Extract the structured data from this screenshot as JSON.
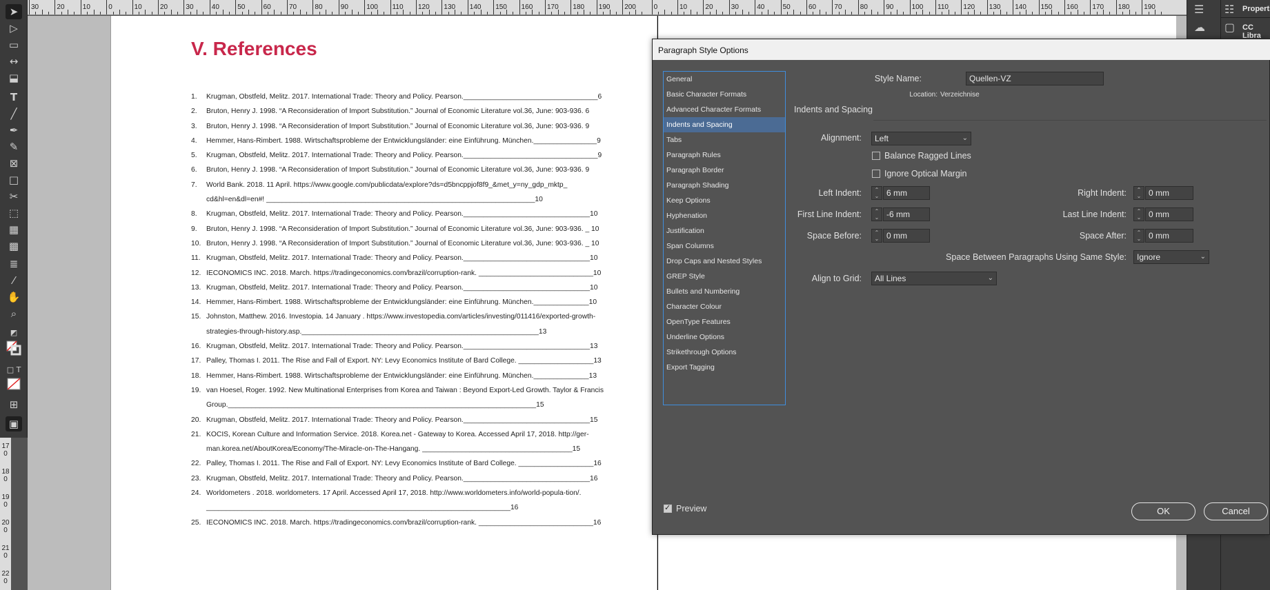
{
  "ruler": {
    "top_labels": [
      "30",
      "20",
      "10",
      "0",
      "10",
      "20",
      "30",
      "40",
      "50",
      "60",
      "70",
      "80",
      "90",
      "100",
      "110",
      "120",
      "130",
      "140",
      "150",
      "160",
      "170",
      "180",
      "190",
      "200",
      "0",
      "10",
      "20",
      "30",
      "40",
      "50",
      "60",
      "70",
      "80",
      "90",
      "100",
      "110",
      "120",
      "130",
      "140",
      "150",
      "160",
      "170",
      "180",
      "190"
    ],
    "left_labels": [
      "170",
      "180",
      "190",
      "200",
      "210",
      "220"
    ]
  },
  "document": {
    "heading": "V.  References",
    "references": [
      {
        "num": "1.",
        "text": "Krugman, Obstfeld, Melitz. 2017. International Trade: Theory and Policy. Pearson.__________________________________6"
      },
      {
        "num": "2.",
        "text": "Bruton, Henry J. 1998. “A Reconsideration of Import Substitution.” Journal of Economic Literature vol.36, June: 903-936.  6"
      },
      {
        "num": "3.",
        "text": "Bruton, Henry J. 1998. “A Reconsideration of Import Substitution.” Journal of Economic Literature vol.36, June: 903-936.  9"
      },
      {
        "num": "4.",
        "text": "Hemmer, Hans-Rimbert. 1988. Wirtschaftsprobleme der Entwicklungsländer: eine Einführung. München.________________9"
      },
      {
        "num": "5.",
        "text": "Krugman, Obstfeld, Melitz. 2017. International Trade: Theory and Policy. Pearson.__________________________________9"
      },
      {
        "num": "6.",
        "text": "Bruton, Henry J. 1998. “A Reconsideration of Import Substitution.” Journal of Economic Literature vol.36, June: 903-936.  9"
      },
      {
        "num": "7.",
        "text": "World Bank. 2018. 11 April. https://www.google.com/publicdata/explore?ds=d5bncppjof8f9_&met_y=ny_gdp_mktp_ cd&hl=en&dl=en#! ____________________________________________________________________10"
      },
      {
        "num": "8.",
        "text": "Krugman, Obstfeld, Melitz. 2017. International Trade: Theory and Policy. Pearson.________________________________10"
      },
      {
        "num": "9.",
        "text": "Bruton, Henry J. 1998. “A Reconsideration of Import Substitution.” Journal of Economic Literature vol.36, June: 903-936. _ 10"
      },
      {
        "num": "10.",
        "text": "Bruton, Henry J. 1998. “A Reconsideration of Import Substitution.” Journal of Economic Literature vol.36, June: 903-936. _ 10"
      },
      {
        "num": "11.",
        "text": "Krugman, Obstfeld, Melitz. 2017. International Trade: Theory and Policy. Pearson.________________________________10"
      },
      {
        "num": "12.",
        "text": "IECONOMICS INC. 2018. March. https://tradingeconomics.com/brazil/corruption-rank. _____________________________10"
      },
      {
        "num": "13.",
        "text": "Krugman, Obstfeld, Melitz. 2017. International Trade: Theory and Policy. Pearson.________________________________10"
      },
      {
        "num": "14.",
        "text": "Hemmer, Hans-Rimbert. 1988. Wirtschaftsprobleme der Entwicklungsländer: eine Einführung. München.______________10"
      },
      {
        "num": "15.",
        "text": "Johnston, Matthew. 2016. Investopia. 14 January . https://www.investopedia.com/articles/investing/011416/exported-growth-strategies-through-history.asp.____________________________________________________________13"
      },
      {
        "num": "16.",
        "text": "Krugman, Obstfeld, Melitz. 2017. International Trade: Theory and Policy. Pearson.________________________________13"
      },
      {
        "num": "17.",
        "text": "Palley, Thomas I. 2011. The Rise and Fall of Export. NY: Levy Economics Institute of Bard College. ___________________13"
      },
      {
        "num": "18.",
        "text": "Hemmer, Hans-Rimbert. 1988. Wirtschaftsprobleme der Entwicklungsländer: eine Einführung. München.______________13"
      },
      {
        "num": "19.",
        "text": "van Hoesel, Roger. 1992. New Multinational Enterprises from Korea and Taiwan : Beyond Export-Led Growth. Taylor & Francis Group.______________________________________________________________________________15"
      },
      {
        "num": "20.",
        "text": "Krugman, Obstfeld, Melitz. 2017. International Trade: Theory and Policy. Pearson.________________________________15"
      },
      {
        "num": "21.",
        "text": "KOCIS, Korean Culture and Information Service. 2018. Korea.net - Gateway to Korea. Accessed April 17, 2018. http://ger-man.korea.net/AboutKorea/Economy/The-Miracle-on-The-Hangang. ______________________________________15"
      },
      {
        "num": "22.",
        "text": "Palley, Thomas I. 2011. The Rise and Fall of Export. NY: Levy Economics Institute of Bard College. ___________________16"
      },
      {
        "num": "23.",
        "text": "Krugman, Obstfeld, Melitz. 2017. International Trade: Theory and Policy. Pearson.________________________________16"
      },
      {
        "num": "24.",
        "text": "Worldometers . 2018. worldometers. 17 April. Accessed April 17, 2018. http://www.worldometers.info/world-popula-tion/. _____________________________________________________________________________16"
      },
      {
        "num": "25.",
        "text": "IECONOMICS INC. 2018. March. https://tradingeconomics.com/brazil/corruption-rank. _____________________________16"
      }
    ]
  },
  "right_panel": {
    "properties_label": "Properti",
    "cc_label": "CC Libra"
  },
  "dialog": {
    "title": "Paragraph Style Options",
    "categories": [
      "General",
      "Basic Character Formats",
      "Advanced Character Formats",
      "Indents and Spacing",
      "Tabs",
      "Paragraph Rules",
      "Paragraph Border",
      "Paragraph Shading",
      "Keep Options",
      "Hyphenation",
      "Justification",
      "Span Columns",
      "Drop Caps and Nested Styles",
      "GREP Style",
      "Bullets and Numbering",
      "Character Colour",
      "OpenType Features",
      "Underline Options",
      "Strikethrough Options",
      "Export Tagging"
    ],
    "selected_category": "Indents and Spacing",
    "style_name_label": "Style Name:",
    "style_name_value": "Quellen-VZ",
    "location_label": "Location:",
    "location_value": "Verzeichnise",
    "section_title": "Indents and Spacing",
    "alignment_label": "Alignment:",
    "alignment_value": "Left",
    "balance_ragged_label": "Balance Ragged Lines",
    "balance_ragged_checked": false,
    "ignore_optical_label": "Ignore Optical Margin",
    "ignore_optical_checked": false,
    "left_indent_label": "Left Indent:",
    "left_indent_value": "6 mm",
    "right_indent_label": "Right Indent:",
    "right_indent_value": "0 mm",
    "first_line_label": "First Line Indent:",
    "first_line_value": "-6 mm",
    "last_line_label": "Last Line Indent:",
    "last_line_value": "0 mm",
    "space_before_label": "Space Before:",
    "space_before_value": "0 mm",
    "space_after_label": "Space After:",
    "space_after_value": "0 mm",
    "space_between_label": "Space Between Paragraphs Using Same Style:",
    "space_between_value": "Ignore",
    "align_grid_label": "Align to Grid:",
    "align_grid_value": "All Lines",
    "preview_label": "Preview",
    "preview_checked": true,
    "ok_label": "OK",
    "cancel_label": "Cancel"
  },
  "tools": [
    "selection-tool",
    "direct-selection-tool",
    "page-tool",
    "gap-tool",
    "content-collector-tool",
    "type-tool",
    "line-tool",
    "pen-tool",
    "pencil-tool",
    "rectangle-frame-tool",
    "rectangle-tool",
    "scissors-tool",
    "free-transform-tool",
    "gradient-swatch-tool",
    "gradient-feather-tool",
    "note-tool",
    "eyedropper-tool",
    "hand-tool",
    "zoom-tool"
  ]
}
